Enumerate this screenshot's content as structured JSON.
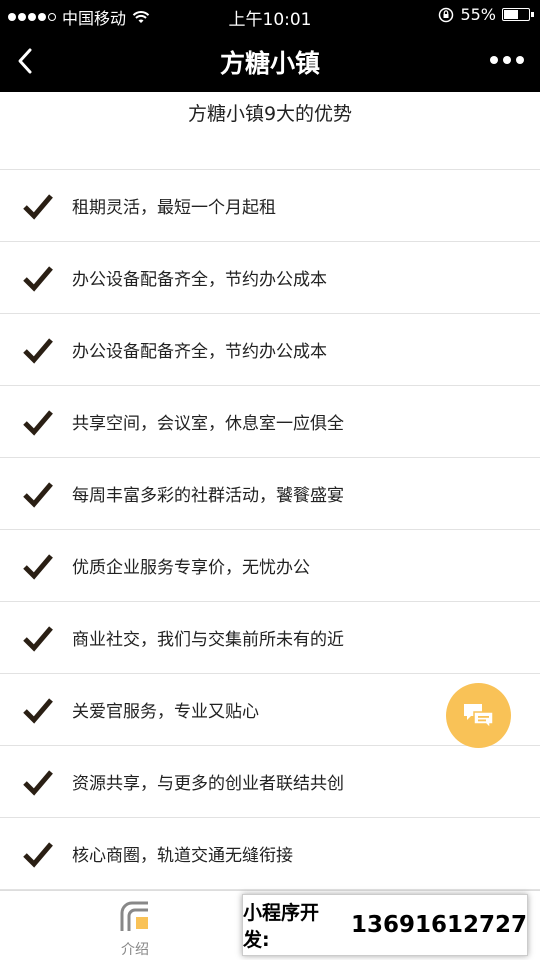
{
  "status_bar": {
    "carrier": "中国移动",
    "time": "上午10:01",
    "battery": "55%",
    "battery_level": 0.55
  },
  "nav": {
    "title": "方糖小镇"
  },
  "section": {
    "title": "方糖小镇9大的优势"
  },
  "benefits": [
    "租期灵活，最短一个月起租",
    "办公设备配备齐全，节约办公成本",
    "办公设备配备齐全，节约办公成本",
    "共享空间，会议室，休息室一应俱全",
    "每周丰富多彩的社群活动，饕餮盛宴",
    "优质企业服务专享价，无忧办公",
    "商业社交，我们与交集前所未有的近",
    "关爱官服务，专业又贴心",
    "资源共享，与更多的创业者联结共创",
    "核心商圈，轨道交通无缝衔接"
  ],
  "tab_bar": {
    "intro_label": "介绍"
  },
  "watermark": {
    "label": "小程序开发:",
    "phone": "13691612727"
  },
  "colors": {
    "bar_bg": "#000000",
    "fab": "#f9c257",
    "check": "#2a1f14"
  }
}
